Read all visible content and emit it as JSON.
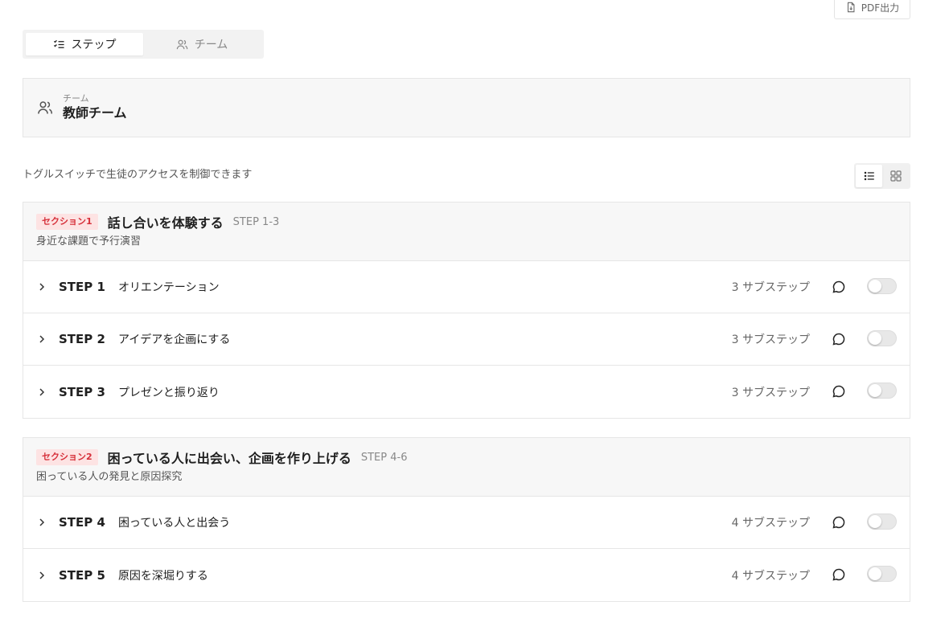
{
  "toolbar": {
    "pdf_label": "PDF出力"
  },
  "tabs": [
    {
      "label": "ステップ",
      "icon": "list-check-icon",
      "active": true
    },
    {
      "label": "チーム",
      "icon": "users-icon",
      "active": false
    }
  ],
  "team": {
    "label": "チーム",
    "name": "教師チーム"
  },
  "hint": "トグルスイッチで生徒のアクセスを制御できます",
  "view_modes": [
    {
      "icon": "list-view-icon",
      "active": true
    },
    {
      "icon": "grid-view-icon",
      "active": false
    }
  ],
  "sections": [
    {
      "badge": "セクション1",
      "title": "話し合いを体験する",
      "range": "STEP 1-3",
      "subtitle": "身近な課題で予行演習",
      "steps": [
        {
          "num": "STEP 1",
          "name": "オリエンテーション",
          "count": "3 サブステップ"
        },
        {
          "num": "STEP 2",
          "name": "アイデアを企画にする",
          "count": "3 サブステップ"
        },
        {
          "num": "STEP 3",
          "name": "プレゼンと振り返り",
          "count": "3 サブステップ"
        }
      ]
    },
    {
      "badge": "セクション2",
      "title": "困っている人に出会い、企画を作り上げる",
      "range": "STEP 4-6",
      "subtitle": "困っている人の発見と原因探究",
      "steps": [
        {
          "num": "STEP 4",
          "name": "困っている人と出会う",
          "count": "4 サブステップ"
        },
        {
          "num": "STEP 5",
          "name": "原因を深堀りする",
          "count": "4 サブステップ"
        }
      ]
    }
  ]
}
